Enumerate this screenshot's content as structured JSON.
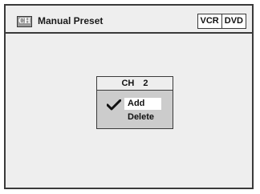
{
  "header": {
    "icon_label": "CH",
    "title": "Manual Preset",
    "modes": [
      "VCR",
      "DVD"
    ]
  },
  "popup": {
    "header_channel": "CH 2",
    "options": [
      {
        "label": "Add",
        "checked": true
      },
      {
        "label": "Delete",
        "checked": false
      }
    ]
  },
  "colors": {
    "screen_bg": "#eeeeee",
    "border": "#3a3a3a",
    "popup_bg": "#cccccc",
    "selection_bg": "#ffffff"
  }
}
